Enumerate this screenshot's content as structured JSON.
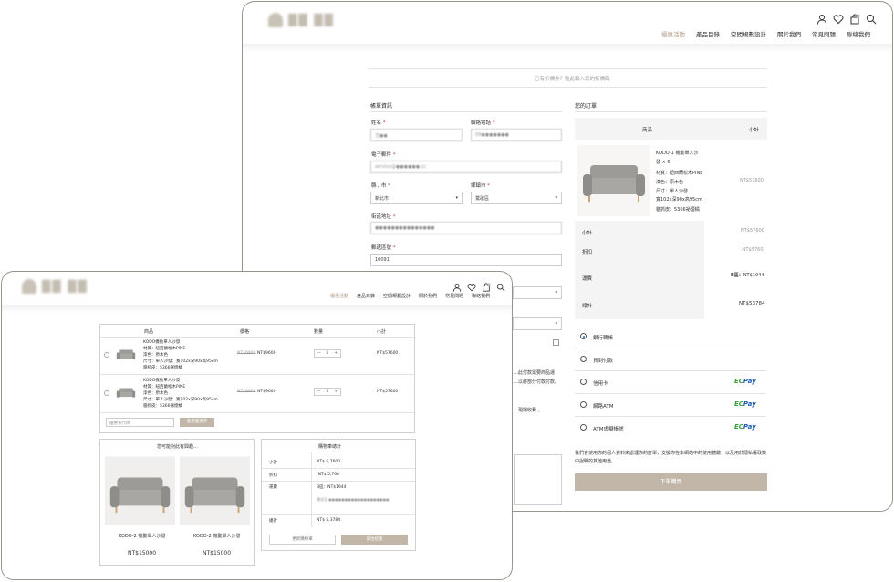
{
  "back": {
    "nav": [
      "優惠活動",
      "產品目錄",
      "空間規劃設計",
      "關於我們",
      "常見問題",
      "聯絡我們"
    ],
    "coupon_notice": "已有折價券？點此輸入您的折價碼",
    "billing_title": "帳單資訊",
    "fields": {
      "name_label": "姓名",
      "name_value": "王●●",
      "phone_label": "聯絡電話",
      "phone_value": "09●●●●●●●",
      "email_label": "電子郵件",
      "email_value": "service@●●●●●●.cc",
      "city_label": "縣 / 市",
      "city_value": "新北市",
      "district_label": "鄉鎮市",
      "district_value": "鶯歌區",
      "address_label": "街道地址",
      "address_value": "●●●●●●●●●●●●●●●",
      "zip_label": "郵遞區號",
      "zip_value": "10091"
    },
    "req_mark": "*",
    "hidden_text": {
      "line1": "…此付款需要商品運",
      "line2": "…以將部分付款付款。",
      "line3": "…現場收費 。"
    },
    "order": {
      "title": "您的訂單",
      "col_product": "商品",
      "col_subtotal": "小計",
      "product_name": "KODO-1 機動單人沙",
      "product_qty": "發 × 6",
      "material": "材質：紐西蘭松木PINE",
      "color": "漆色：原木色",
      "size": "尺寸：單人沙發",
      "size2": "寬102x深90x高95cm",
      "fabric": "貓抓皮：5366祕煙橘",
      "product_price": "NT$57600",
      "subtotal_label": "小計",
      "subtotal_value": "NT$57600",
      "discount_label": "折扣",
      "discount_value": "-NT$5760",
      "shipping_label": "運費",
      "shipping_zone": "B區：",
      "shipping_value": "NT$1944",
      "total_label": "總計",
      "total_value": "NT$53784"
    },
    "payments": [
      {
        "label": "銀行轉帳",
        "selected": true,
        "ecpay": false
      },
      {
        "label": "貨到付款",
        "selected": false,
        "ecpay": false
      },
      {
        "label": "信用卡",
        "selected": false,
        "ecpay": true
      },
      {
        "label": "網路ATM",
        "selected": false,
        "ecpay": true
      },
      {
        "label": "ATM虛擬帳號",
        "selected": false,
        "ecpay": true
      }
    ],
    "ecpay_a": "EC",
    "ecpay_b": "Pay",
    "privacy": "我們會使用你的個人資料來處理你的訂單，支援你在本網站中的使用體驗，以及用於隱私權政策中說明的其他用途。",
    "submit": "下單購買"
  },
  "front": {
    "nav": [
      "優惠活動",
      "產品目錄",
      "空間規劃設計",
      "關於我們",
      "常見問題",
      "聯絡我們"
    ],
    "cart_headers": [
      "商品",
      "價格",
      "數量",
      "小計"
    ],
    "cart_items": [
      {
        "name": "KODO機動單人沙發",
        "material": "材質：紐西蘭松木PINE",
        "color": "漆色：原木色",
        "size": "尺寸：單人沙發：寬102x深90x高95cm",
        "fabric": "貓抓皮：5366祕煙橘",
        "old_price": "NT$9900",
        "price": "NT$9600",
        "qty": "6",
        "subtotal": "NT$57600"
      },
      {
        "name": "KODO機動單人沙發",
        "material": "材質：紐西蘭松木PINE",
        "color": "漆色：原木色",
        "size": "尺寸：單人沙發：寬102x深90x高95cm",
        "fabric": "貓抓皮：5366祕煙橘",
        "old_price": "NT$9900",
        "price": "NT$9600",
        "qty": "6",
        "subtotal": "NT$57600"
      }
    ],
    "coupon_placeholder": "優惠券代碼",
    "coupon_button": "套用優惠券",
    "recommend_title": "您可能對此有興趣…",
    "recommend": [
      {
        "name": "KODO-2 機動單人沙發",
        "price": "NT$15000"
      },
      {
        "name": "KODO-2 機動單人沙發",
        "price": "NT$15000"
      }
    ],
    "totals_title": "購物車總計",
    "subtotal_label": "小計",
    "subtotal_value": "NT$ 5,7600",
    "discount_label": "折扣",
    "discount_value": "-NT$ 5,760",
    "shipping_label": "運費",
    "shipping_value": "B區：NT$1944",
    "shipping_note": "運送至 ●●●●●●●●●●●●●●●●●●●",
    "total_label": "總計",
    "total_value": "NT$ 5,3784",
    "update_button": "更新購物車",
    "checkout_button": "前往結帳",
    "qty_minus": "−",
    "qty_plus": "+"
  }
}
